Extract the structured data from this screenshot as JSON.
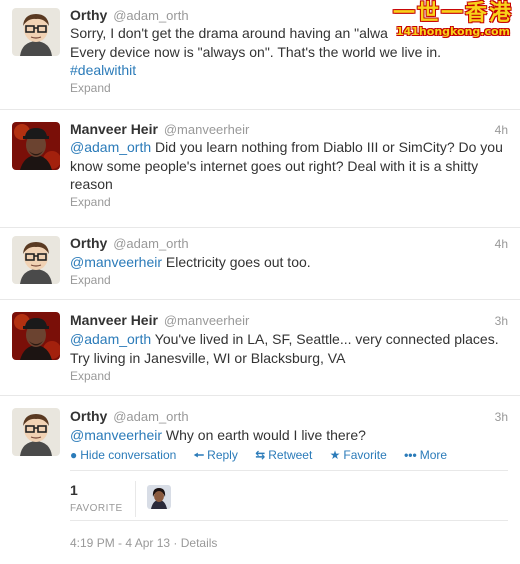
{
  "watermark": {
    "title": "一世一香港",
    "url": "141hongkong.com"
  },
  "tweets": [
    {
      "name": "Orthy",
      "handle": "@adam_orth",
      "time": "",
      "lines": [
        "Sorry, I don't get the drama around having an \"alwa",
        "Every device now is \"always on\". That's the world we live in."
      ],
      "hashtag": "#dealwithit",
      "expand": "Expand"
    },
    {
      "name": "Manveer Heir",
      "handle": "@manveerheir",
      "time": "4h",
      "mention": "@adam_orth",
      "line1": " Did you learn nothing from Diablo III or SimCity? Do you",
      "line2": "know some people's internet goes out right? Deal with it is a shitty",
      "line3": "reason",
      "expand": "Expand"
    },
    {
      "name": "Orthy",
      "handle": "@adam_orth",
      "time": "4h",
      "mention": "@manveerheir",
      "line1": " Electricity goes out too.",
      "expand": "Expand"
    },
    {
      "name": "Manveer Heir",
      "handle": "@manveerheir",
      "time": "3h",
      "mention": "@adam_orth",
      "line1": " You've lived in LA, SF, Seattle... very connected places.",
      "line2": "Try living in Janesville, WI or Blacksburg, VA",
      "expand": "Expand"
    },
    {
      "name": "Orthy",
      "handle": "@adam_orth",
      "time": "3h",
      "mention": "@manveerheir",
      "line1": " Why on earth would I live there?",
      "actions": {
        "hide": "Hide conversation",
        "reply": "Reply",
        "retweet": "Retweet",
        "favorite": "Favorite",
        "more": "More"
      }
    }
  ],
  "favorites": {
    "count": "1",
    "label": "FAVORITE"
  },
  "footer": {
    "timestamp": "4:19 PM - 4 Apr 13",
    "separator": " · ",
    "details": "Details"
  },
  "colors": {
    "link": "#2b7bb9",
    "muted": "#999999",
    "text": "#333333"
  }
}
